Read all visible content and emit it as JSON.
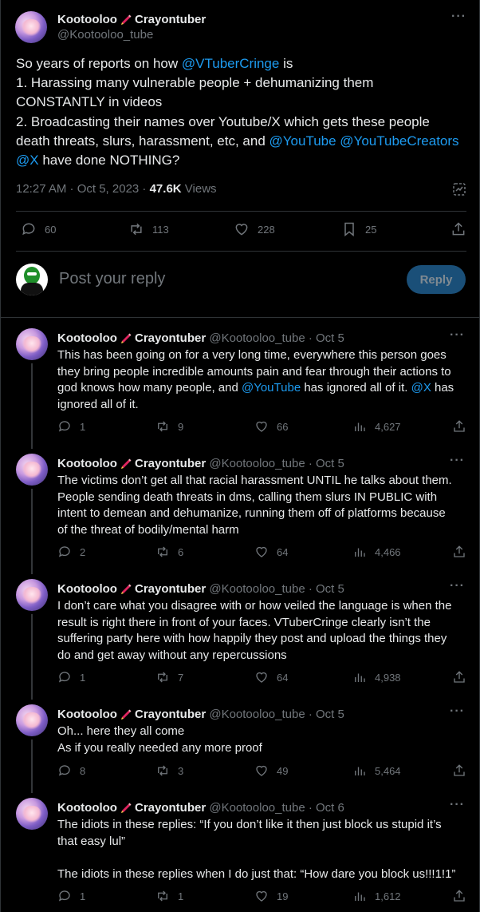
{
  "main_tweet": {
    "display_name": "Kootooloo",
    "display_name_suffix": "Crayontuber",
    "handle": "@Kootooloo_tube",
    "body_lines": [
      [
        {
          "t": "So years of reports on how "
        },
        {
          "t": "@VTuberCringe",
          "m": true
        },
        {
          "t": " is"
        }
      ],
      [
        {
          "t": "1. Harassing many vulnerable people + dehumanizing them"
        }
      ],
      [
        {
          "t": "CONSTANTLY in videos"
        }
      ],
      [
        {
          "t": "2. Broadcasting their names over Youtube/X which gets these people"
        }
      ],
      [
        {
          "t": "death threats, slurs, harassment, etc, and "
        },
        {
          "t": "@YouTube",
          "m": true
        },
        {
          "t": " "
        },
        {
          "t": "@YouTubeCreators",
          "m": true
        }
      ],
      [
        {
          "t": "@X",
          "m": true
        },
        {
          "t": " have done NOTHING?"
        }
      ]
    ],
    "time": "12:27 AM · Oct 5, 2023 · ",
    "views_count": "47.6K",
    "views_label": " Views",
    "replies": "60",
    "reposts": "113",
    "likes": "228",
    "bookmarks": "25"
  },
  "reply_box": {
    "placeholder": "Post your reply",
    "button": "Reply"
  },
  "colors": {
    "accent": "#1d9bf0",
    "secondary_text": "#71767b",
    "divider": "#2f3336",
    "reply_button_bg": "#1a4f78"
  },
  "replies": [
    {
      "name": "Kootooloo",
      "suffix": "Crayontuber",
      "handle_date": " @Kootooloo_tube · Oct 5",
      "lines": [
        [
          {
            "t": "This has been going on for a very long time, everywhere this person goes"
          }
        ],
        [
          {
            "t": "they bring people incredible amounts pain and fear through their actions to"
          }
        ],
        [
          {
            "t": "god knows how many people, and "
          },
          {
            "t": "@YouTube",
            "m": true
          },
          {
            "t": " has ignored all of it. "
          },
          {
            "t": "@X",
            "m": true
          },
          {
            "t": " has"
          }
        ],
        [
          {
            "t": "ignored all of it."
          }
        ]
      ],
      "replies": "1",
      "reposts": "9",
      "likes": "66",
      "views": "4,627"
    },
    {
      "name": "Kootooloo",
      "suffix": "Crayontuber",
      "handle_date": " @Kootooloo_tube · Oct 5",
      "lines": [
        [
          {
            "t": "The victims don’t get all that racial harassment UNTIL he talks about them."
          }
        ],
        [
          {
            "t": "People sending death threats in dms, calling them slurs IN PUBLIC with"
          }
        ],
        [
          {
            "t": "intent to demean and dehumanize, running them off of platforms because"
          }
        ],
        [
          {
            "t": "of the threat of bodily/mental harm"
          }
        ]
      ],
      "replies": "2",
      "reposts": "6",
      "likes": "64",
      "views": "4,466"
    },
    {
      "name": "Kootooloo",
      "suffix": "Crayontuber",
      "handle_date": " @Kootooloo_tube · Oct 5",
      "lines": [
        [
          {
            "t": "I don’t care what you disagree with or how veiled the language is when the"
          }
        ],
        [
          {
            "t": "result is right there in front of your faces. VTuberCringe clearly isn’t the"
          }
        ],
        [
          {
            "t": "suffering party here with how happily they post and upload the things they"
          }
        ],
        [
          {
            "t": "do and get away without any repercussions"
          }
        ]
      ],
      "replies": "1",
      "reposts": "7",
      "likes": "64",
      "views": "4,938"
    },
    {
      "name": "Kootooloo",
      "suffix": "Crayontuber",
      "handle_date": " @Kootooloo_tube · Oct 5",
      "lines": [
        [
          {
            "t": "Oh... here they all come"
          }
        ],
        [
          {
            "t": "As if you really needed any more proof"
          }
        ]
      ],
      "replies": "8",
      "reposts": "3",
      "likes": "49",
      "views": "5,464"
    },
    {
      "name": "Kootooloo",
      "suffix": "Crayontuber",
      "handle_date": " @Kootooloo_tube · Oct 6",
      "lines": [
        [
          {
            "t": "The idiots in these replies: “If you don’t like it then just block us stupid it’s"
          }
        ],
        [
          {
            "t": "that easy lul”"
          }
        ],
        [
          {
            "t": ""
          }
        ],
        [
          {
            "t": "The idiots in these replies when I do just that: “How dare you block us!!!1!1”"
          }
        ]
      ],
      "replies": "1",
      "reposts": "1",
      "likes": "19",
      "views": "1,612"
    }
  ]
}
